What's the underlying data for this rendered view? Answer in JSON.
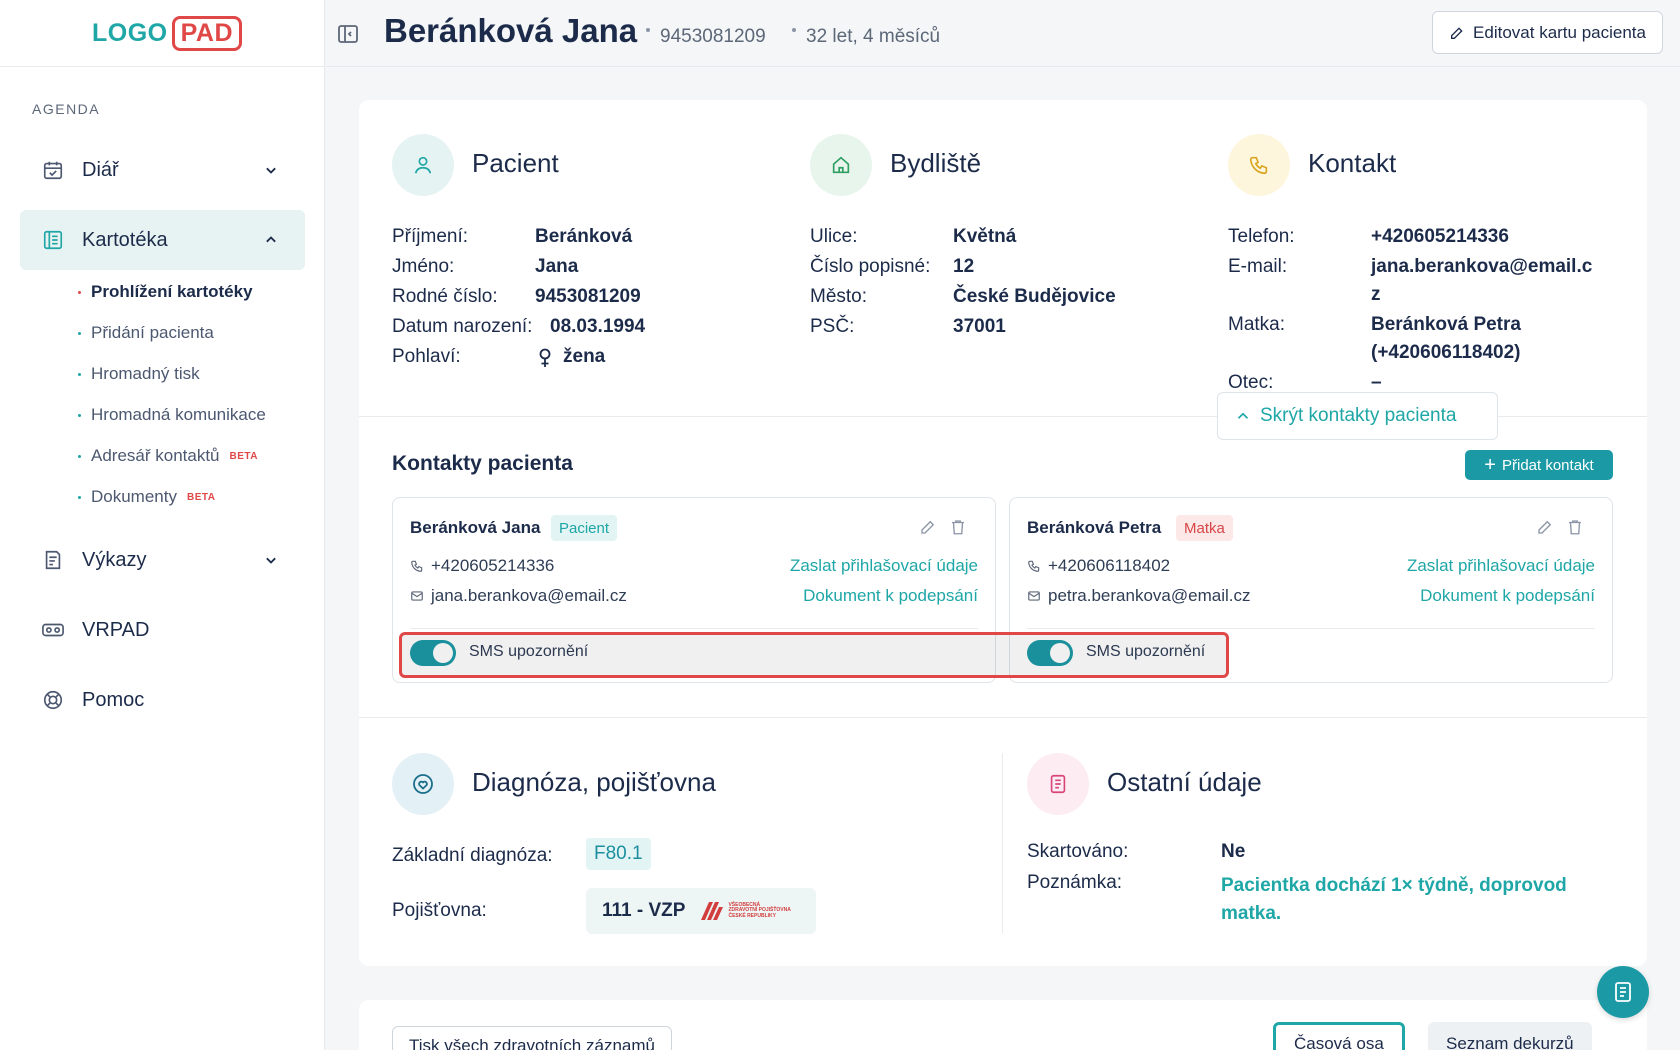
{
  "app": {
    "logo_part1": "LOGO",
    "logo_part2": "PAD"
  },
  "sidebar": {
    "section_label": "AGENDA",
    "items": [
      {
        "label": "Diář"
      },
      {
        "label": "Kartotéka"
      },
      {
        "label": "Výkazy"
      },
      {
        "label": "VRPAD"
      },
      {
        "label": "Pomoc"
      }
    ],
    "subitems": [
      {
        "label": "Prohlížení kartotéky"
      },
      {
        "label": "Přidání pacienta"
      },
      {
        "label": "Hromadný tisk"
      },
      {
        "label": "Hromadná komunikace"
      },
      {
        "label": "Adresář kontaktů",
        "badge": "BETA"
      },
      {
        "label": "Dokumenty",
        "badge": "BETA"
      }
    ]
  },
  "header": {
    "patient_name": "Beránková Jana",
    "birth_number": "9453081209",
    "age": "32 let, 4 měsíců",
    "edit_button": "Editovat kartu pacienta"
  },
  "patient": {
    "title": "Pacient",
    "rows": [
      {
        "label": "Příjmení:",
        "value": "Beránková"
      },
      {
        "label": "Jméno:",
        "value": "Jana"
      },
      {
        "label": "Rodné číslo:",
        "value": "9453081209"
      },
      {
        "label": "Datum narození:",
        "value": "08.03.1994"
      },
      {
        "label": "Pohlaví:",
        "value": "žena"
      }
    ]
  },
  "address": {
    "title": "Bydliště",
    "rows": [
      {
        "label": "Ulice:",
        "value": "Květná"
      },
      {
        "label": "Číslo popisné:",
        "value": "12"
      },
      {
        "label": "Město:",
        "value": "České Budějovice"
      },
      {
        "label": "PSČ:",
        "value": "37001"
      }
    ]
  },
  "contact": {
    "title": "Kontakt",
    "phone_label": "Telefon:",
    "phone_value": "+420605214336",
    "email_label": "E-mail:",
    "email_value_line1": "jana.berankova@email.c",
    "email_value_line2": "z",
    "mother_label": "Matka:",
    "mother_value_line1": "Beránková Petra",
    "mother_value_line2": "(+420606118402)",
    "father_label": "Otec:",
    "father_value": "–"
  },
  "hide_contacts_button": "Skrýt kontakty pacienta",
  "contacts": {
    "title": "Kontakty pacienta",
    "add_button": "Přidat kontakt",
    "cards": [
      {
        "name": "Beránková Jana",
        "badge": "Pacient",
        "phone": "+420605214336",
        "email": "jana.berankova@email.cz",
        "link_send": "Zaslat přihlašovací údaje",
        "link_sign": "Dokument k podepsání",
        "sms_label": "SMS upozornění",
        "sms_enabled": true
      },
      {
        "name": "Beránková Petra",
        "badge": "Matka",
        "phone": "+420606118402",
        "email": "petra.berankova@email.cz",
        "link_send": "Zaslat přihlašovací údaje",
        "link_sign": "Dokument k podepsání",
        "sms_label": "SMS upozornění",
        "sms_enabled": true
      }
    ]
  },
  "diagnosis": {
    "title": "Diagnóza, pojišťovna",
    "basic_label": "Základní diagnóza:",
    "basic_value": "F80.1",
    "insurer_label": "Pojišťovna:",
    "insurer_value": "111 - VZP",
    "insurer_logo_line1": "VŠEOBECNÁ",
    "insurer_logo_line2": "ZDRAVOTNÍ POJIŠŤOVNA",
    "insurer_logo_line3": "ČESKÉ REPUBLIKY"
  },
  "other": {
    "title": "Ostatní údaje",
    "shred_label": "Skartováno:",
    "shred_value": "Ne",
    "note_label": "Poznámka:",
    "note_value": "Pacientka dochází 1× týdně, doprovod matka."
  },
  "bottom": {
    "print_button": "Tisk všech zdravotních záznamů",
    "tab_timeline": "Časová osa",
    "tab_list": "Seznam dekurzů"
  },
  "colors": {
    "accent": "#1fa6a6",
    "brand_red": "#e04848",
    "text_dark": "#1c2b4a"
  }
}
